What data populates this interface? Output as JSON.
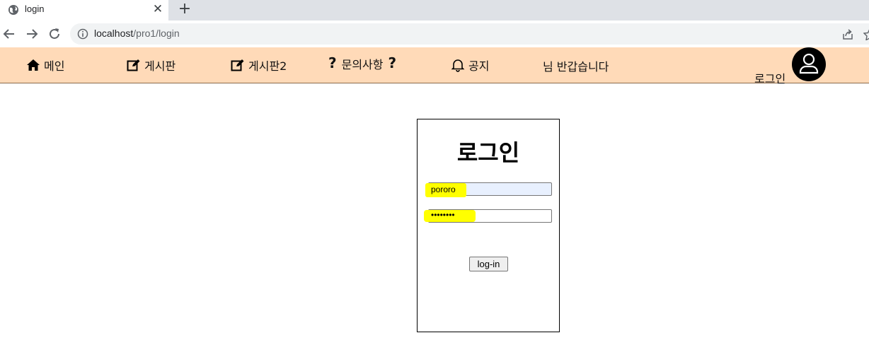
{
  "browser": {
    "tab_title": "login",
    "tab_close": "✕",
    "new_tab": "+",
    "url_host": "localhost",
    "url_path": "/pro1/login"
  },
  "nav": {
    "items": [
      {
        "label": "메인",
        "icon": "home-icon"
      },
      {
        "label": "게시판",
        "icon": "edit-icon"
      },
      {
        "label": "게시판2",
        "icon": "edit-icon"
      },
      {
        "label": "문의사항",
        "icon": "question-icon"
      },
      {
        "label": "공지",
        "icon": "bell-icon"
      }
    ],
    "question_mark": "?",
    "greeting": "님 반갑습니다",
    "login_link": "로그인",
    "background": "#ffdab8"
  },
  "login": {
    "title": "로그인",
    "id_value": "pororo",
    "password_mask": "••••••••",
    "button_label": "log-in",
    "highlight_color": "#ffff00"
  }
}
